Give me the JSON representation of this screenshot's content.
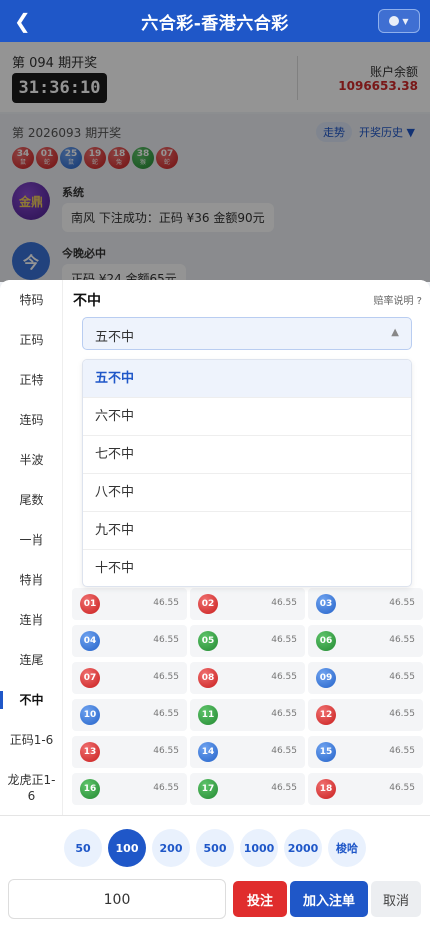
{
  "header": {
    "back_icon": "chevron-left-icon",
    "title": "六合彩-香港六合彩"
  },
  "period": {
    "current_label": "第 094 期开奖",
    "countdown": "31:36:10",
    "balance_label": "账户余额",
    "balance_value": "1096653.38"
  },
  "last_draw": {
    "label": "第 2026093 期开奖",
    "trend_label": "走势",
    "history_label": "开奖历史 ▼",
    "balls": [
      {
        "num": "34",
        "zodiac": "鼠",
        "color": "red"
      },
      {
        "num": "01",
        "zodiac": "蛇",
        "color": "red"
      },
      {
        "num": "25",
        "zodiac": "鼠",
        "color": "blue"
      },
      {
        "num": "19",
        "zodiac": "蛇",
        "color": "red"
      },
      {
        "num": "18",
        "zodiac": "兔",
        "color": "red"
      },
      {
        "num": "38",
        "zodiac": "猴",
        "color": "green"
      },
      {
        "num": "07",
        "zodiac": "蛇",
        "color": "red"
      }
    ]
  },
  "chat": {
    "messages": [
      {
        "avatar_text": "金鼎",
        "name": "系统",
        "text": "南风 下注成功：正码 ¥36 金额90元"
      },
      {
        "avatar_text": "今",
        "name": "今晚必中",
        "text": "正码 ¥24 金额65元"
      }
    ]
  },
  "sidebar": {
    "items": [
      "特码",
      "正码",
      "正特",
      "连码",
      "半波",
      "尾数",
      "一肖",
      "特肖",
      "连肖",
      "连尾",
      "不中",
      "正码1-6",
      "龙虎正1-6"
    ],
    "active": "不中"
  },
  "main": {
    "title": "不中",
    "odds_link": "赔率说明 ?",
    "select_value": "五不中",
    "options": [
      "五不中",
      "六不中",
      "七不中",
      "八不中",
      "九不中",
      "十不中"
    ],
    "numbers": [
      {
        "num": "01",
        "odds": "46.55",
        "color": "red"
      },
      {
        "num": "02",
        "odds": "46.55",
        "color": "red"
      },
      {
        "num": "03",
        "odds": "46.55",
        "color": "blue"
      },
      {
        "num": "04",
        "odds": "46.55",
        "color": "blue"
      },
      {
        "num": "05",
        "odds": "46.55",
        "color": "green"
      },
      {
        "num": "06",
        "odds": "46.55",
        "color": "green"
      },
      {
        "num": "07",
        "odds": "46.55",
        "color": "red"
      },
      {
        "num": "08",
        "odds": "46.55",
        "color": "red"
      },
      {
        "num": "09",
        "odds": "46.55",
        "color": "blue"
      },
      {
        "num": "10",
        "odds": "46.55",
        "color": "blue"
      },
      {
        "num": "11",
        "odds": "46.55",
        "color": "green"
      },
      {
        "num": "12",
        "odds": "46.55",
        "color": "red"
      },
      {
        "num": "13",
        "odds": "46.55",
        "color": "red"
      },
      {
        "num": "14",
        "odds": "46.55",
        "color": "blue"
      },
      {
        "num": "15",
        "odds": "46.55",
        "color": "blue"
      },
      {
        "num": "16",
        "odds": "46.55",
        "color": "green"
      },
      {
        "num": "17",
        "odds": "46.55",
        "color": "green"
      },
      {
        "num": "18",
        "odds": "46.55",
        "color": "red"
      }
    ]
  },
  "bottom": {
    "chips": [
      "50",
      "100",
      "200",
      "500",
      "1000",
      "2000",
      "梭哈"
    ],
    "active_chip": "100",
    "amount": "100",
    "bet_label": "投注",
    "add_label": "加入注单",
    "cancel_label": "取消"
  },
  "colors": {
    "primary": "#1f57c8",
    "danger": "#e02d2d",
    "ball_red": "#c91e1e",
    "ball_blue": "#2563c9",
    "ball_green": "#248a33"
  }
}
